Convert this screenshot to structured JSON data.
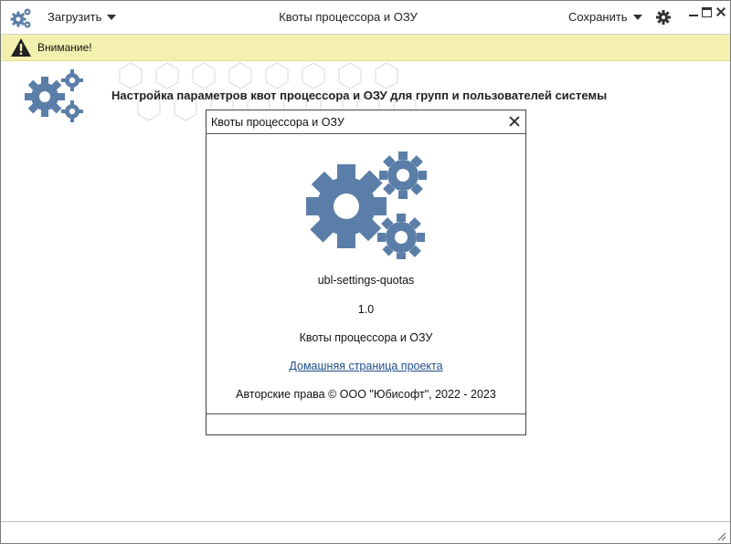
{
  "app": {
    "title": "Квоты процессора и ОЗУ",
    "load_label": "Загрузить",
    "save_label": "Сохранить"
  },
  "warning": {
    "text": "Внимание!"
  },
  "header": {
    "description": "Настройка параметров квот процессора и ОЗУ для групп и пользователей системы"
  },
  "about_dialog": {
    "title": "Квоты процессора и ОЗУ",
    "package_name": "ubl-settings-quotas",
    "version": "1.0",
    "app_name": "Квоты процессора и ОЗУ",
    "homepage_link": "Домашняя страница проекта",
    "copyright": "Авторские права © ООО \"Юбисофт\", 2022 - 2023"
  },
  "icons": {
    "app": "gears-icon",
    "settings": "gear-icon",
    "warning": "warning-icon"
  },
  "colors": {
    "gear_blue": "#5b7ea8",
    "warning_bg": "#f4f1b0",
    "link": "#1f4e8a"
  }
}
